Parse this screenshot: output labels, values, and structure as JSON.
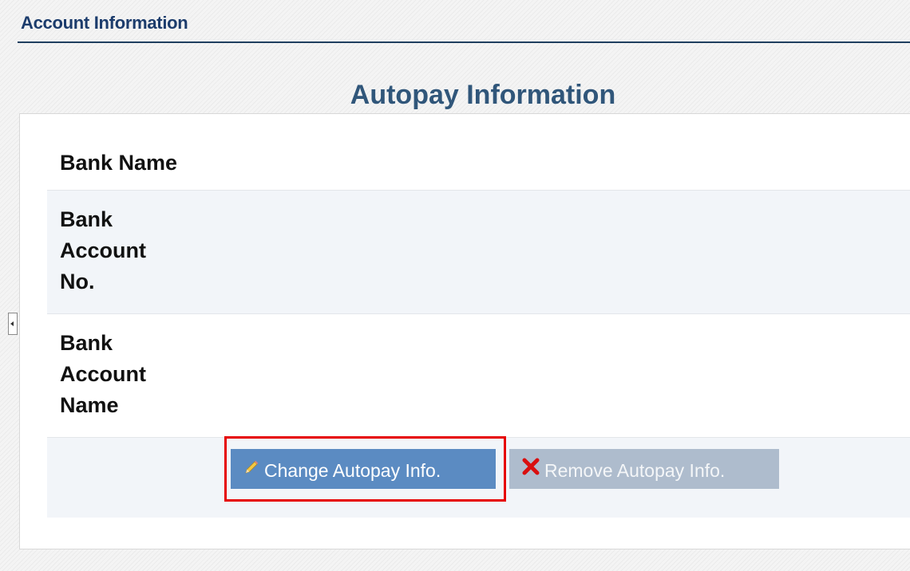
{
  "header": {
    "title": "Account Information"
  },
  "panel": {
    "title": "Autopay Information"
  },
  "fields": {
    "bank_name": {
      "label": "Bank Name",
      "value": ""
    },
    "bank_account_no": {
      "label": "Bank Account No.",
      "value": ""
    },
    "bank_account_name": {
      "label": "Bank Account Name",
      "value": ""
    }
  },
  "actions": {
    "change_label": "Change Autopay Info.",
    "change_icon": "pencil-icon",
    "remove_label": "Remove Autopay Info.",
    "remove_icon": "red-x-icon"
  },
  "colors": {
    "header_text": "#1c3c6c",
    "panel_title": "#30567a",
    "change_button": "#5b8bc2",
    "remove_button": "#aebccd",
    "highlight": "#e60000"
  }
}
